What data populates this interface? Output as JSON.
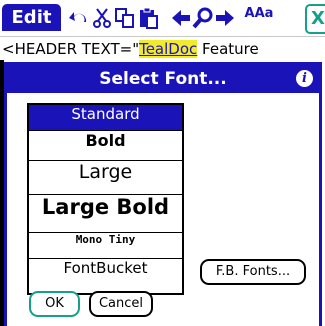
{
  "toolbar": {
    "edit_label": "Edit",
    "icons": [
      "undo-icon",
      "cut-icon",
      "copy-icon",
      "paste-icon",
      "left-arrow-icon",
      "find-icon",
      "right-arrow-icon",
      "font-size-icon",
      "close-icon"
    ],
    "font_icon_label": "AAa",
    "close_label": "X"
  },
  "document": {
    "prefix": "<HEADER TEXT=\"",
    "highlight": "TealDoc",
    "suffix": " Feature"
  },
  "dialog": {
    "title": "Select Font...",
    "info_label": "i",
    "fonts": [
      "Standard",
      "Bold",
      "Large",
      "Large Bold",
      "Mono Tiny",
      "FontBucket"
    ],
    "selected_font": "Standard",
    "fb_fonts_label": "F.B. Fonts...",
    "ok_label": "OK",
    "cancel_label": "Cancel"
  },
  "colors": {
    "accent": "#1a13b8",
    "highlight": "#f2ea2c",
    "ok_border": "#14a08a"
  }
}
